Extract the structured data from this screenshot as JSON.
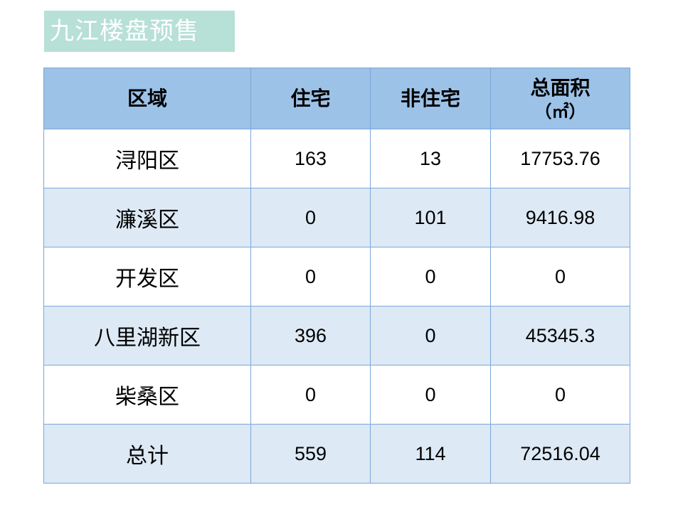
{
  "title": "九江楼盘预售",
  "table": {
    "headers": {
      "region": "区域",
      "residential": "住宅",
      "non_residential": "非住宅",
      "total_area": "总面积",
      "total_area_unit": "（㎡）"
    },
    "rows": [
      {
        "region": "浔阳区",
        "residential": "163",
        "non_residential": "13",
        "total_area": "17753.76"
      },
      {
        "region": "濂溪区",
        "residential": "0",
        "non_residential": "101",
        "total_area": "9416.98"
      },
      {
        "region": "开发区",
        "residential": "0",
        "non_residential": "0",
        "total_area": "0"
      },
      {
        "region": "八里湖新区",
        "residential": "396",
        "non_residential": "0",
        "total_area": "45345.3"
      },
      {
        "region": "柴桑区",
        "residential": "0",
        "non_residential": "0",
        "total_area": "0"
      },
      {
        "region": "总计",
        "residential": "559",
        "non_residential": "114",
        "total_area": "72516.04"
      }
    ]
  },
  "colors": {
    "title_bg": "#b7e0d6",
    "header_bg": "#9cc2e7",
    "row_alt_bg": "#dde9f5",
    "border": "#7ba7d8"
  }
}
